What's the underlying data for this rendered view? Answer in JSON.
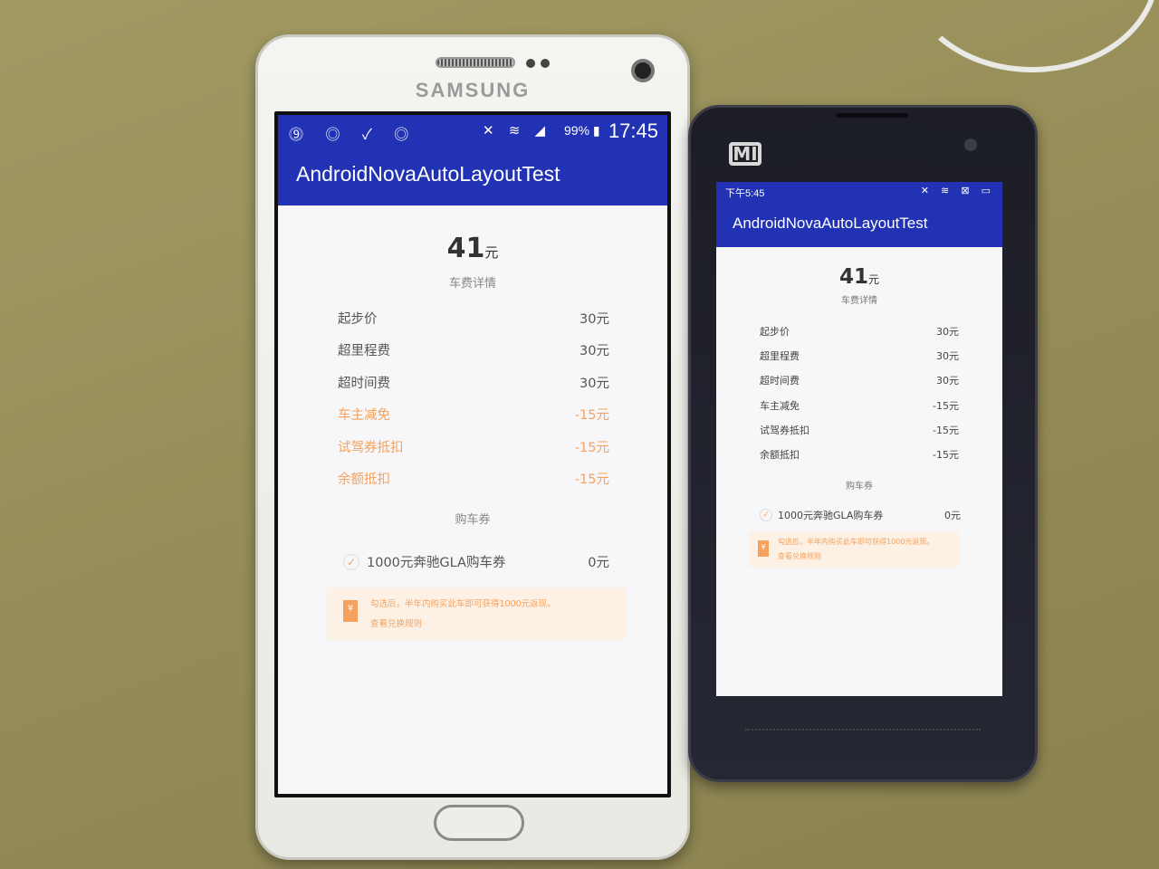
{
  "samsung": {
    "brand": "SAMSUNG",
    "status": {
      "left_icons": "⓽ ◎ ✓ ◎",
      "right_icons": "✕ ≋ ◢",
      "battery": "99% ▮",
      "time": "17:45"
    },
    "app_title": "AndroidNovaAutoLayoutTest",
    "total_amount": "41",
    "total_unit": "元",
    "subtitle": "车费详情",
    "fees": [
      {
        "label": "起步价",
        "value": "30元"
      },
      {
        "label": "超里程费",
        "value": "30元"
      },
      {
        "label": "超时间费",
        "value": "30元"
      },
      {
        "label": "车主减免",
        "value": "-15元"
      },
      {
        "label": "试驾券抵扣",
        "value": "-15元"
      },
      {
        "label": "余额抵扣",
        "value": "-15元"
      }
    ],
    "coupon_title": "购车券",
    "coupon": {
      "check_icon": "✓",
      "name": "1000元奔驰GLA购车券",
      "value": "0元"
    },
    "tip": {
      "ribbon_icon": "¥",
      "line1": "勾选后，半年内购买此车即可获得1000元返现。",
      "line2": "查看兑换规则"
    }
  },
  "xiaomi": {
    "brand": "MI",
    "status": {
      "time": "下午5:45",
      "icons": "✕ ≋ ⊠ ▭"
    },
    "app_title": "AndroidNovaAutoLayoutTest",
    "total_amount": "41",
    "total_unit": "元",
    "subtitle": "车费详情",
    "fees": [
      {
        "label": "起步价",
        "value": "30元"
      },
      {
        "label": "超里程费",
        "value": "30元"
      },
      {
        "label": "超时间费",
        "value": "30元"
      },
      {
        "label": "车主减免",
        "value": "-15元"
      },
      {
        "label": "试驾券抵扣",
        "value": "-15元"
      },
      {
        "label": "余额抵扣",
        "value": "-15元"
      }
    ],
    "coupon_title": "购车券",
    "coupon": {
      "check_icon": "✓",
      "name": "1000元奔驰GLA购车券",
      "value": "0元"
    },
    "tip": {
      "ribbon_icon": "¥",
      "line1": "勾选后，半年内购买此车即可获得1000元返现。",
      "line2": "查看兑换规则"
    }
  },
  "colors": {
    "primary": "#2232b5",
    "accent_orange": "#f5a25f",
    "text_dark": "#555555",
    "tip_bg": "#fdf0e4"
  }
}
